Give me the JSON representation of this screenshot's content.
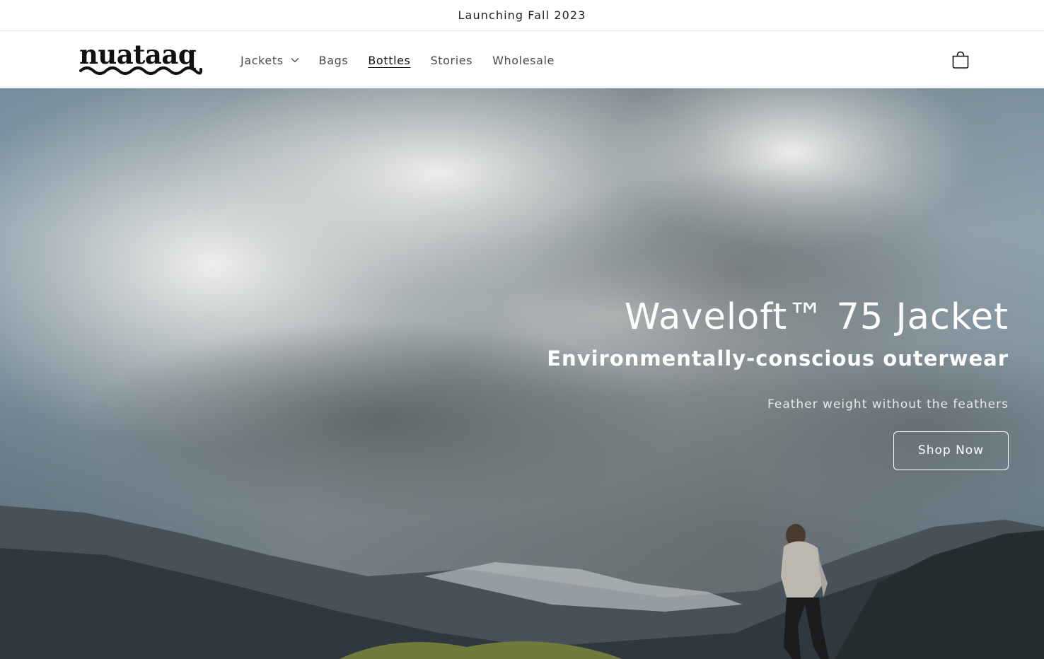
{
  "announcement": {
    "text": "Launching Fall 2023"
  },
  "header": {
    "logo_text": "nuataaq",
    "nav": [
      {
        "label": "Jackets",
        "has_dropdown": true
      },
      {
        "label": "Bags"
      },
      {
        "label": "Bottles",
        "active": true
      },
      {
        "label": "Stories"
      },
      {
        "label": "Wholesale"
      }
    ],
    "cart_icon": "cart-icon"
  },
  "hero": {
    "title": "Waveloft™ 75 Jacket",
    "subtitle": "Environmentally-conscious outerwear",
    "tagline": "Feather weight without the feathers",
    "cta": "Shop Now"
  },
  "colors": {
    "text": "#121212",
    "border": "#e4e4e4",
    "hero_text": "#ffffff"
  }
}
